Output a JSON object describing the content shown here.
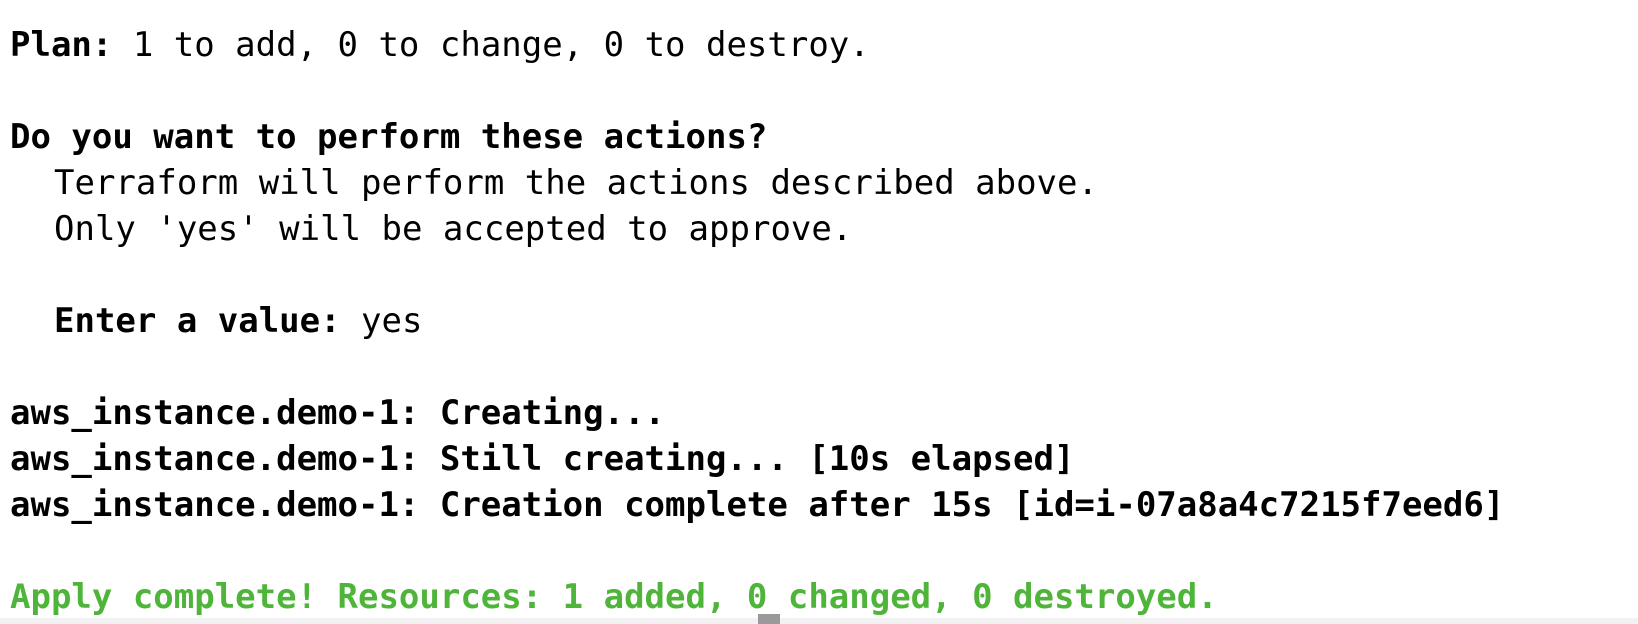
{
  "plan": {
    "label": "Plan:",
    "summary": " 1 to add, 0 to change, 0 to destroy."
  },
  "prompt": {
    "question": "Do you want to perform these actions?",
    "line1": "Terraform will perform the actions described above.",
    "line2": "Only 'yes' will be accepted to approve."
  },
  "input": {
    "label": "Enter a value:",
    "value": " yes"
  },
  "progress": [
    "aws_instance.demo-1: Creating...",
    "aws_instance.demo-1: Still creating... [10s elapsed]",
    "aws_instance.demo-1: Creation complete after 15s [id=i-07a8a4c7215f7eed6]"
  ],
  "result": "Apply complete! Resources: 1 added, 0 changed, 0 destroyed.",
  "colors": {
    "success": "#4fb53a",
    "text": "#000000",
    "background": "#ffffff"
  }
}
